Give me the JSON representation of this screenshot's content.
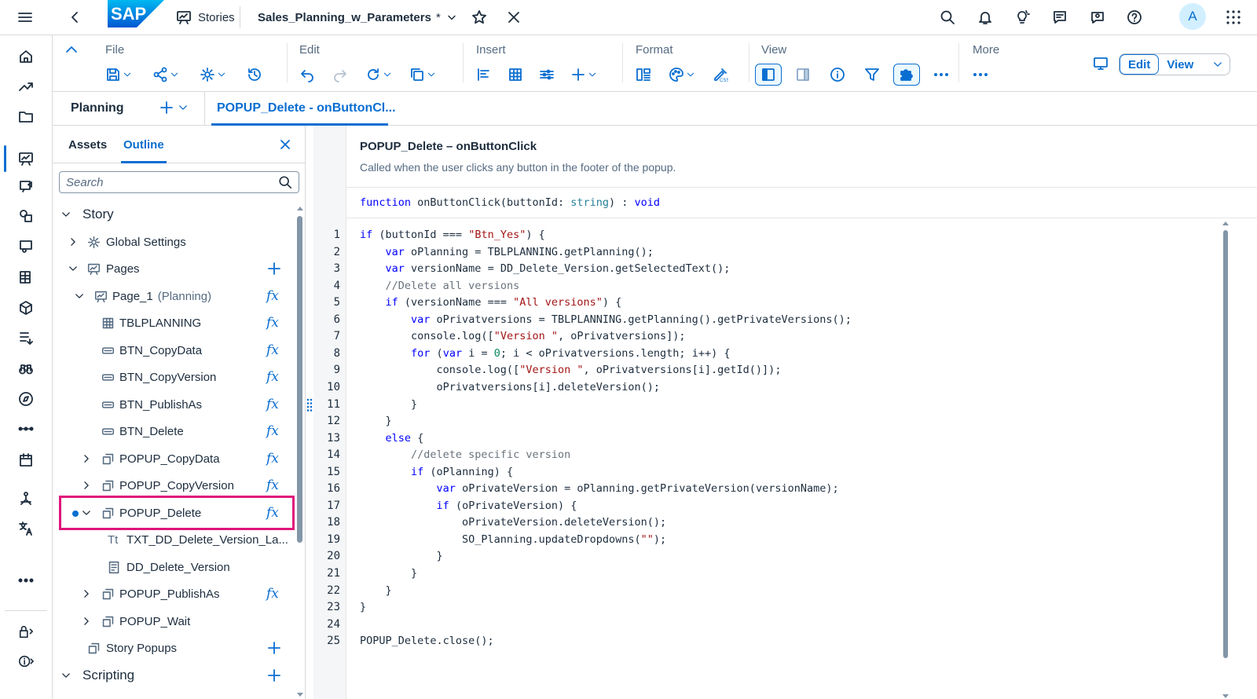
{
  "shell": {
    "app_logo": "SAP",
    "stories_label": "Stories",
    "story_title": "Sales_Planning_w_Parameters",
    "modified_marker": "*",
    "avatar_initial": "A"
  },
  "toolbar": {
    "groups": {
      "file": "File",
      "edit": "Edit",
      "insert": "Insert",
      "format": "Format",
      "view": "View",
      "more": "More"
    },
    "mode_edit": "Edit",
    "mode_view": "View"
  },
  "tabs": {
    "planning": "Planning",
    "script_tab": "POPUP_Delete - onButtonCl..."
  },
  "panel": {
    "tab_assets": "Assets",
    "tab_outline": "Outline",
    "search_placeholder": "Search",
    "tree": [
      {
        "label": "Story"
      },
      {
        "label": "Global Settings"
      },
      {
        "label": "Pages"
      },
      {
        "label": "Page_1",
        "sub": "(Planning)"
      },
      {
        "label": "TBLPLANNING"
      },
      {
        "label": "BTN_CopyData"
      },
      {
        "label": "BTN_CopyVersion"
      },
      {
        "label": "BTN_PublishAs"
      },
      {
        "label": "BTN_Delete"
      },
      {
        "label": "POPUP_CopyData"
      },
      {
        "label": "POPUP_CopyVersion"
      },
      {
        "label": "POPUP_Delete"
      },
      {
        "label": "TXT_DD_Delete_Version_La..."
      },
      {
        "label": "DD_Delete_Version"
      },
      {
        "label": "POPUP_PublishAs"
      },
      {
        "label": "POPUP_Wait"
      },
      {
        "label": "Story Popups"
      },
      {
        "label": "Scripting"
      }
    ],
    "fx_label": "fx"
  },
  "editor": {
    "title": "POPUP_Delete – onButtonClick",
    "description": "Called when the user clicks any button in the footer of the popup.",
    "signature": {
      "kw_function": "function",
      "name": " onButtonClick(buttonId: ",
      "param_type": "string",
      "close": ") : ",
      "ret_type": "void"
    },
    "line_numbers": [
      "1",
      "2",
      "3",
      "4",
      "5",
      "6",
      "7",
      "8",
      "9",
      "10",
      "11",
      "12",
      "13",
      "14",
      "15",
      "16",
      "17",
      "18",
      "19",
      "20",
      "21",
      "22",
      "23",
      "24",
      "25"
    ],
    "code": [
      [
        [
          "kw",
          "if"
        ],
        [
          "p",
          " (buttonId === "
        ],
        [
          "str",
          "\"Btn_Yes\""
        ],
        [
          "p",
          ") {"
        ]
      ],
      [
        [
          "p",
          "    "
        ],
        [
          "kw",
          "var"
        ],
        [
          "p",
          " oPlanning = TBLPLANNING.getPlanning();"
        ]
      ],
      [
        [
          "p",
          "    "
        ],
        [
          "kw",
          "var"
        ],
        [
          "p",
          " versionName = DD_Delete_Version.getSelectedText();"
        ]
      ],
      [
        [
          "p",
          "    "
        ],
        [
          "cm",
          "//Delete all versions"
        ]
      ],
      [
        [
          "p",
          "    "
        ],
        [
          "kw",
          "if"
        ],
        [
          "p",
          " (versionName === "
        ],
        [
          "str",
          "\"All versions\""
        ],
        [
          "p",
          ") {"
        ]
      ],
      [
        [
          "p",
          "        "
        ],
        [
          "kw",
          "var"
        ],
        [
          "p",
          " oPrivatversions = TBLPLANNING.getPlanning().getPrivateVersions();"
        ]
      ],
      [
        [
          "p",
          "        console.log(["
        ],
        [
          "str",
          "\"Version \""
        ],
        [
          "p",
          ", oPrivatversions]);"
        ]
      ],
      [
        [
          "p",
          "        "
        ],
        [
          "kw",
          "for"
        ],
        [
          "p",
          " ("
        ],
        [
          "kw",
          "var"
        ],
        [
          "p",
          " i = "
        ],
        [
          "num",
          "0"
        ],
        [
          "p",
          "; i < oPrivatversions.length; i++) {"
        ]
      ],
      [
        [
          "p",
          "            console.log(["
        ],
        [
          "str",
          "\"Version \""
        ],
        [
          "p",
          ", oPrivatversions[i].getId()]);"
        ]
      ],
      [
        [
          "p",
          "            oPrivatversions[i].deleteVersion();"
        ]
      ],
      [
        [
          "p",
          "        }"
        ]
      ],
      [
        [
          "p",
          "    }"
        ]
      ],
      [
        [
          "p",
          "    "
        ],
        [
          "kw",
          "else"
        ],
        [
          "p",
          " {"
        ]
      ],
      [
        [
          "p",
          "        "
        ],
        [
          "cm",
          "//delete specific version"
        ]
      ],
      [
        [
          "p",
          "        "
        ],
        [
          "kw",
          "if"
        ],
        [
          "p",
          " (oPlanning) {"
        ]
      ],
      [
        [
          "p",
          "            "
        ],
        [
          "kw",
          "var"
        ],
        [
          "p",
          " oPrivateVersion = oPlanning.getPrivateVersion(versionName);"
        ]
      ],
      [
        [
          "p",
          "            "
        ],
        [
          "kw",
          "if"
        ],
        [
          "p",
          " (oPrivateVersion) {"
        ]
      ],
      [
        [
          "p",
          "                oPrivateVersion.deleteVersion();"
        ]
      ],
      [
        [
          "p",
          "                SO_Planning.updateDropdowns("
        ],
        [
          "str",
          "\"\""
        ],
        [
          "p",
          ");"
        ]
      ],
      [
        [
          "p",
          "            }"
        ]
      ],
      [
        [
          "p",
          "        }"
        ]
      ],
      [
        [
          "p",
          "    }"
        ]
      ],
      [
        [
          "p",
          "}"
        ]
      ],
      [
        [
          "p",
          ""
        ]
      ],
      [
        [
          "p",
          "POPUP_Delete.close();"
        ]
      ]
    ]
  },
  "colors": {
    "accent": "#0a6ed1",
    "selection_border": "#e0157b",
    "keyword": "#0000ff",
    "string": "#a31515",
    "comment": "#6a737d"
  }
}
